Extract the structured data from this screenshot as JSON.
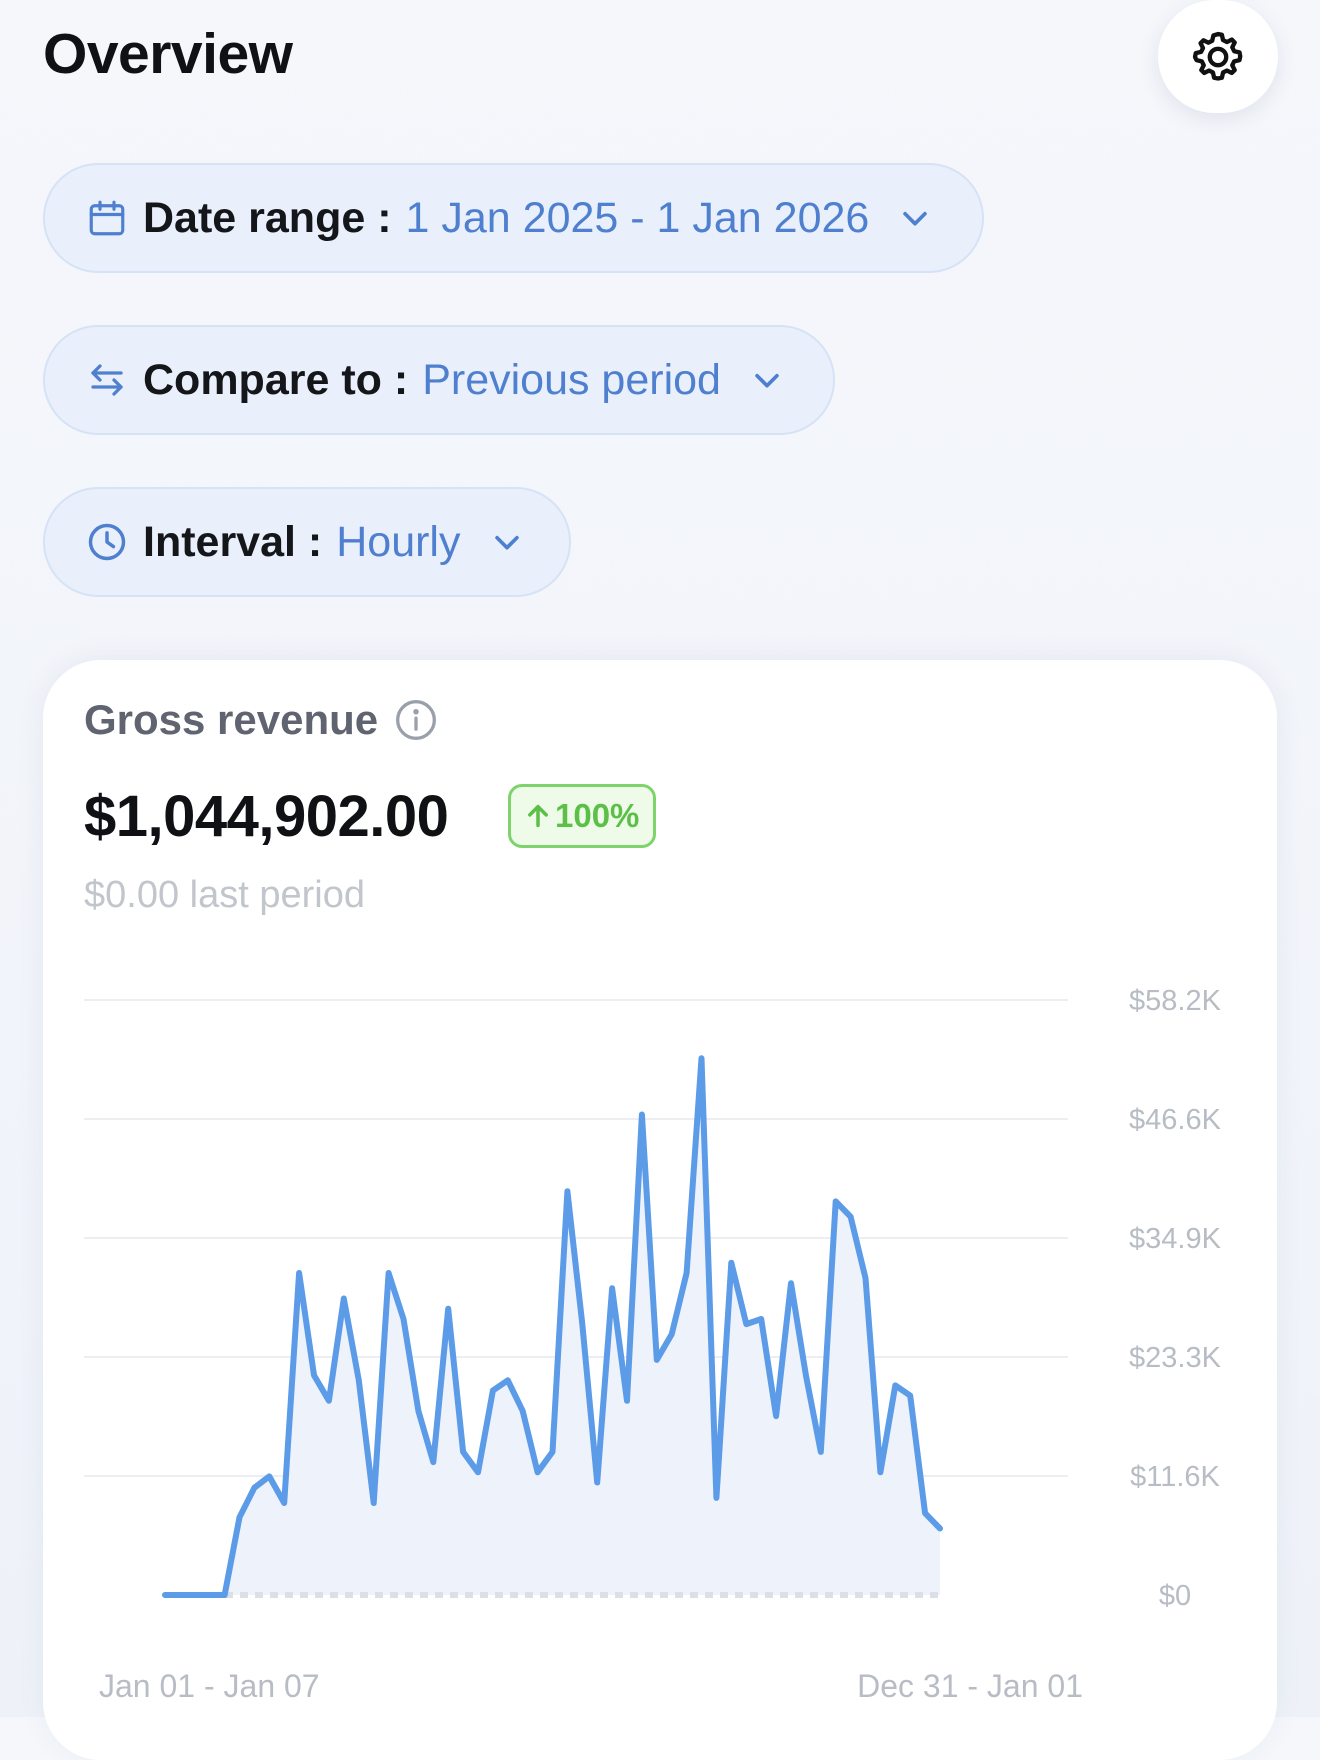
{
  "header": {
    "title": "Overview",
    "settings_icon": "gear-icon"
  },
  "filters": {
    "date_range": {
      "label": "Date range :",
      "value": "1 Jan 2025 - 1 Jan 2026",
      "icon": "calendar-icon"
    },
    "compare_to": {
      "label": "Compare to :",
      "value": "Previous period",
      "icon": "swap-arrows-icon"
    },
    "interval": {
      "label": "Interval :",
      "value": "Hourly",
      "icon": "clock-icon"
    }
  },
  "card": {
    "title": "Gross revenue",
    "value": "$1,044,902.00",
    "delta": "100%",
    "delta_direction": "up",
    "last_period": "$0.00 last period"
  },
  "colors": {
    "accent": "#4f7fcf",
    "line": "#5b9be8",
    "positive": "#5cbf48"
  },
  "chart_data": {
    "type": "line",
    "y_ticks": [
      "$58.2K",
      "$46.6K",
      "$34.9K",
      "$23.3K",
      "$11.6K",
      "$0"
    ],
    "ylim": [
      0,
      58200
    ],
    "x_range_labels": [
      "Jan 01 - Jan 07",
      "Dec 31 - Jan 01"
    ],
    "grid": true,
    "series": [
      {
        "values": [
          0,
          0,
          0,
          0,
          0,
          7600,
          10500,
          11600,
          9000,
          31500,
          21500,
          19000,
          29000,
          21000,
          9000,
          31500,
          27000,
          18000,
          13000,
          28000,
          14000,
          12000,
          20000,
          21000,
          18000,
          12000,
          14000,
          39500,
          26500,
          11000,
          30000,
          19000,
          47000,
          23000,
          25500,
          31500,
          52500,
          9500,
          32500,
          26500,
          27000,
          17500,
          30500,
          21500,
          14000,
          38500,
          37000,
          31000,
          12000,
          20500,
          19500,
          8000,
          6500
        ]
      },
      {
        "values": [
          0,
          0,
          0,
          0,
          0,
          0,
          0,
          0,
          0,
          0,
          0,
          0,
          0,
          0,
          0,
          0,
          0,
          0,
          0,
          0,
          0,
          0,
          0,
          0,
          0,
          0,
          0,
          0,
          0,
          0,
          0,
          0,
          0,
          0,
          0,
          0,
          0,
          0,
          0,
          0,
          0,
          0,
          0,
          0,
          0,
          0,
          0,
          0,
          0,
          0,
          0,
          0,
          0
        ],
        "style": "dashed"
      }
    ]
  }
}
